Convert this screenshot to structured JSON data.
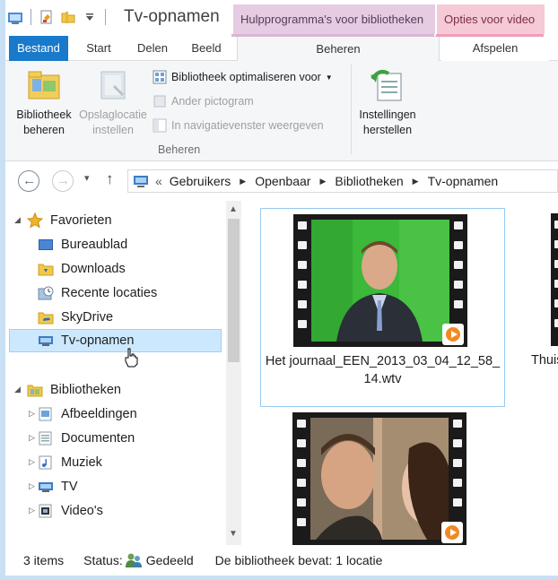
{
  "window": {
    "title": "Tv-opnamen",
    "context_tab_library": "Hulpprogramma's voor bibliotheken",
    "context_tab_video": "Opties voor video"
  },
  "tabs": {
    "file": "Bestand",
    "start": "Start",
    "share": "Delen",
    "view": "Beeld",
    "manage": "Beheren",
    "play": "Afspelen"
  },
  "ribbon": {
    "manage_library": "Bibliotheek beheren",
    "set_save_location": "Opslaglocatie instellen",
    "optimize_library": "Bibliotheek optimaliseren voor",
    "change_icon": "Ander pictogram",
    "show_in_nav": "In navigatievenster weergeven",
    "group_label": "Beheren",
    "restore_settings": "Instellingen herstellen"
  },
  "navbar": {
    "back_glyph": "←",
    "forward_glyph": "→",
    "up_glyph": "↑",
    "recent_glyph": "▾",
    "overflow_glyph": "«",
    "crumbs": [
      "Gebruikers",
      "Openbaar",
      "Bibliotheken",
      "Tv-opnamen"
    ]
  },
  "navpane": {
    "favorites": "Favorieten",
    "desktop": "Bureaublad",
    "downloads": "Downloads",
    "recent": "Recente locaties",
    "skydrive": "SkyDrive",
    "tv": "Tv-opnamen",
    "libraries": "Bibliotheken",
    "pictures": "Afbeeldingen",
    "documents": "Documenten",
    "music": "Muziek",
    "tvlib": "TV",
    "videos": "Video's"
  },
  "files": [
    {
      "name": "Het journaal_EEN_2013_03_04_12_58_14.wtv",
      "selected": true
    },
    {
      "name": "Thuis",
      "selected": false
    },
    {
      "name": "",
      "selected": false
    }
  ],
  "statusbar": {
    "items": "3 items",
    "status_label": "Status:",
    "status_value": "Gedeeld",
    "library_info": "De bibliotheek bevat: 1 locatie"
  },
  "colors": {
    "file_tab": "#1979ca",
    "context_library": "#e5cce2",
    "context_video": "#f5c9d6",
    "selection": "#cce8ff",
    "window_border": "#c9dff3"
  }
}
